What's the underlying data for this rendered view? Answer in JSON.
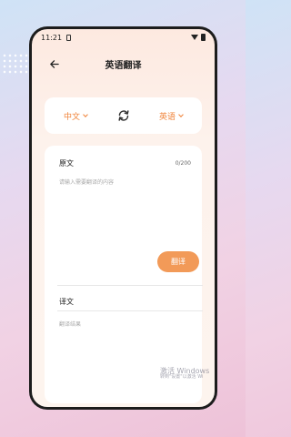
{
  "status_bar": {
    "time": "11:21"
  },
  "header": {
    "title": "英语翻译"
  },
  "languages": {
    "source": "中文",
    "target": "英语"
  },
  "input": {
    "label": "原文",
    "count": "0/200",
    "placeholder": "请输入需要翻译的内容"
  },
  "actions": {
    "translate_label": "翻译"
  },
  "result": {
    "label": "译文",
    "placeholder": "翻译结果"
  },
  "watermark": {
    "line1": "激活 Windows",
    "line2": "转到\"设置\"以激活 Wi"
  },
  "colors": {
    "accent": "#f0843a",
    "button": "#f29a58",
    "card": "#ffffff"
  },
  "icons": {
    "back": "arrow-left-icon",
    "swap": "refresh-swap-icon"
  }
}
